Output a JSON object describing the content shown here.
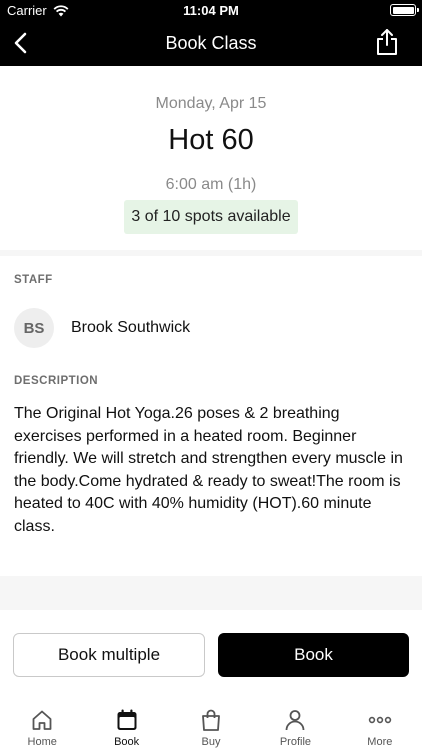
{
  "status_bar": {
    "carrier": "Carrier",
    "time": "11:04 PM"
  },
  "nav": {
    "title": "Book Class"
  },
  "class_info": {
    "date": "Monday, Apr 15",
    "name": "Hot 60",
    "time": "6:00 am (1h)",
    "spots": "3 of 10 spots available"
  },
  "staff": {
    "label": "STAFF",
    "initials": "BS",
    "name": "Brook Southwick"
  },
  "description": {
    "label": "DESCRIPTION",
    "text": "The Original Hot Yoga.26 poses & 2 breathing exercises performed in a heated room. Beginner friendly. We will stretch and strengthen every muscle in the body.Come hydrated & ready to sweat!The room is heated to 40C with 40% humidity (HOT).60 minute class."
  },
  "actions": {
    "book_multiple": "Book multiple",
    "book": "Book"
  },
  "tabs": [
    {
      "label": "Home",
      "icon": "home-icon"
    },
    {
      "label": "Book",
      "icon": "calendar-icon",
      "active": true
    },
    {
      "label": "Buy",
      "icon": "shopping-bag-icon"
    },
    {
      "label": "Profile",
      "icon": "profile-icon"
    },
    {
      "label": "More",
      "icon": "more-icon"
    }
  ],
  "colors": {
    "header_bg": "#000000",
    "spots_badge_bg": "#e6f4e6",
    "primary_button_bg": "#000000"
  }
}
